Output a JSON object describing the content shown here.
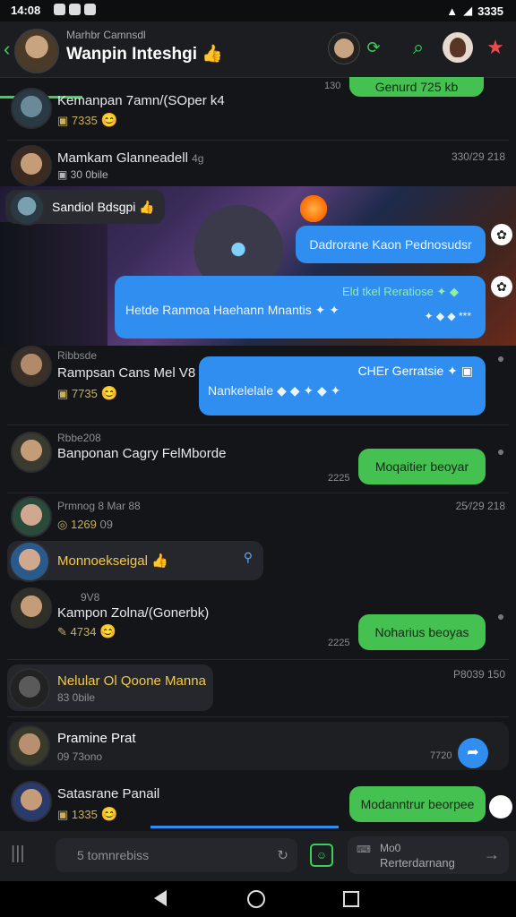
{
  "status_bar": {
    "time": "14:08",
    "battery": "3335"
  },
  "header": {
    "subtitle": "Marhbr Camnsdl",
    "title": "Wanpin Inteshgi",
    "title_emoji": "👍",
    "icons": [
      "avatar-icon",
      "refresh-icon",
      "search-icon",
      "profile-icon",
      "star-icon"
    ]
  },
  "top_bubble": {
    "text": "Genurd 725 kb",
    "time": "130"
  },
  "chats": [
    {
      "name": "Kemanpan 7amn/(SOper k4",
      "meta": "7335",
      "emoji": "😊"
    },
    {
      "name": "Mamkam Glanneadell",
      "meta": "30 0bile",
      "tag": "4g",
      "date": "330/29 218"
    },
    {
      "name": "Sandiol Bdsgpi",
      "emoji": "👍"
    },
    {
      "subtitle": "Ribbsde",
      "name": "Rampsan Cans Mel V8",
      "meta": "7735",
      "emoji": "😊"
    },
    {
      "subtitle": "Rbbe208",
      "name": "Banponan Cagry FelMborde",
      "time": "2225"
    },
    {
      "subtitle": "Prmnog 8 Mar 88",
      "meta": "1269",
      "tag": "09",
      "date": "25∕/29 218"
    },
    {
      "name": "Monnoekseigal",
      "emoji": "👍"
    },
    {
      "subtitle": "9V8",
      "name": "Kampon Zolna/(Gonerbk)",
      "meta": "4734",
      "emoji": "😊",
      "time": "2225"
    },
    {
      "name": "Nelular Ol Qoone Manna",
      "meta": "83 0bile",
      "date": "P8039 150"
    },
    {
      "name": "Pramine Prat",
      "meta": "09 73ono",
      "time": "7720"
    },
    {
      "name": "Satasrane Panail",
      "meta": "1335",
      "emoji": "😊"
    }
  ],
  "bubbles": {
    "media_1": "Dadrorane Kaon Pednosudsr",
    "media_2_head": "Eld tkel Reratiose",
    "media_2_body": "Hetde Ranmoa Haehann Mnantis",
    "media_2_time": "***",
    "blue_head": "CHEr Gerratsie",
    "blue_body": "Nankelelale",
    "green_1": "Moqaitier beoyar",
    "green_2": "Noharius beoyas",
    "green_3": "Modanntrur beorpee"
  },
  "input": {
    "placeholder": "5 tomnrebiss",
    "right_sub": "Mo0",
    "right_main": "Rerterdarnang"
  }
}
